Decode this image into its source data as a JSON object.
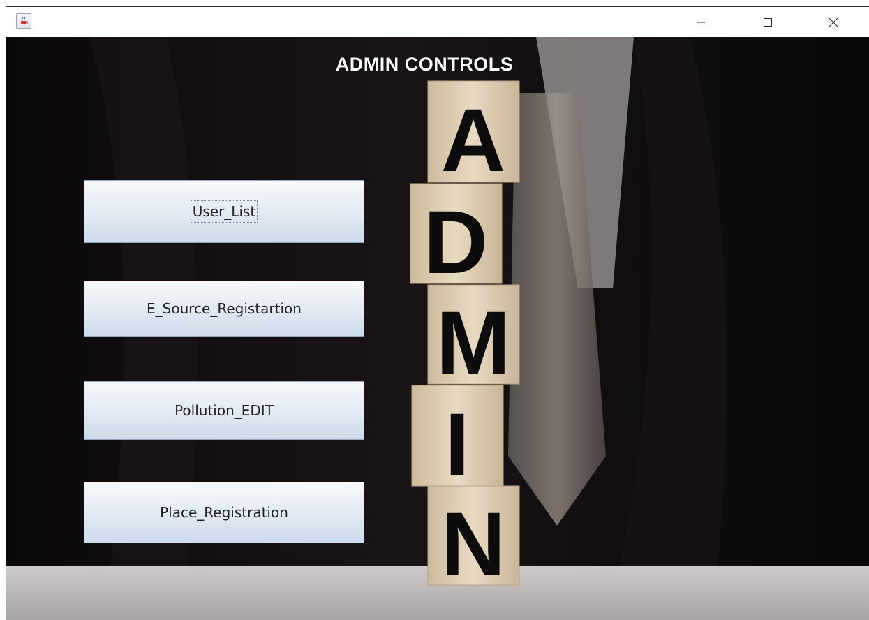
{
  "window": {
    "app_icon": "java-coffee-cup-icon",
    "controls": {
      "minimize": "minimize-icon",
      "maximize": "maximize-icon",
      "close": "close-icon"
    }
  },
  "main": {
    "title": "ADMIN CONTROLS",
    "buttons": [
      {
        "label": "User_List"
      },
      {
        "label": "E_Source_Registartion"
      },
      {
        "label": "Pollution_EDIT"
      },
      {
        "label": "Place_Registration"
      }
    ],
    "blocks": [
      "A",
      "D",
      "M",
      "I",
      "N"
    ]
  },
  "colors": {
    "background_dark": "#0b0809",
    "block_wood": "#e3d3b8",
    "button_top": "#f7f9fc",
    "button_bottom": "#cddbeb",
    "title_text": "#ffffff"
  }
}
